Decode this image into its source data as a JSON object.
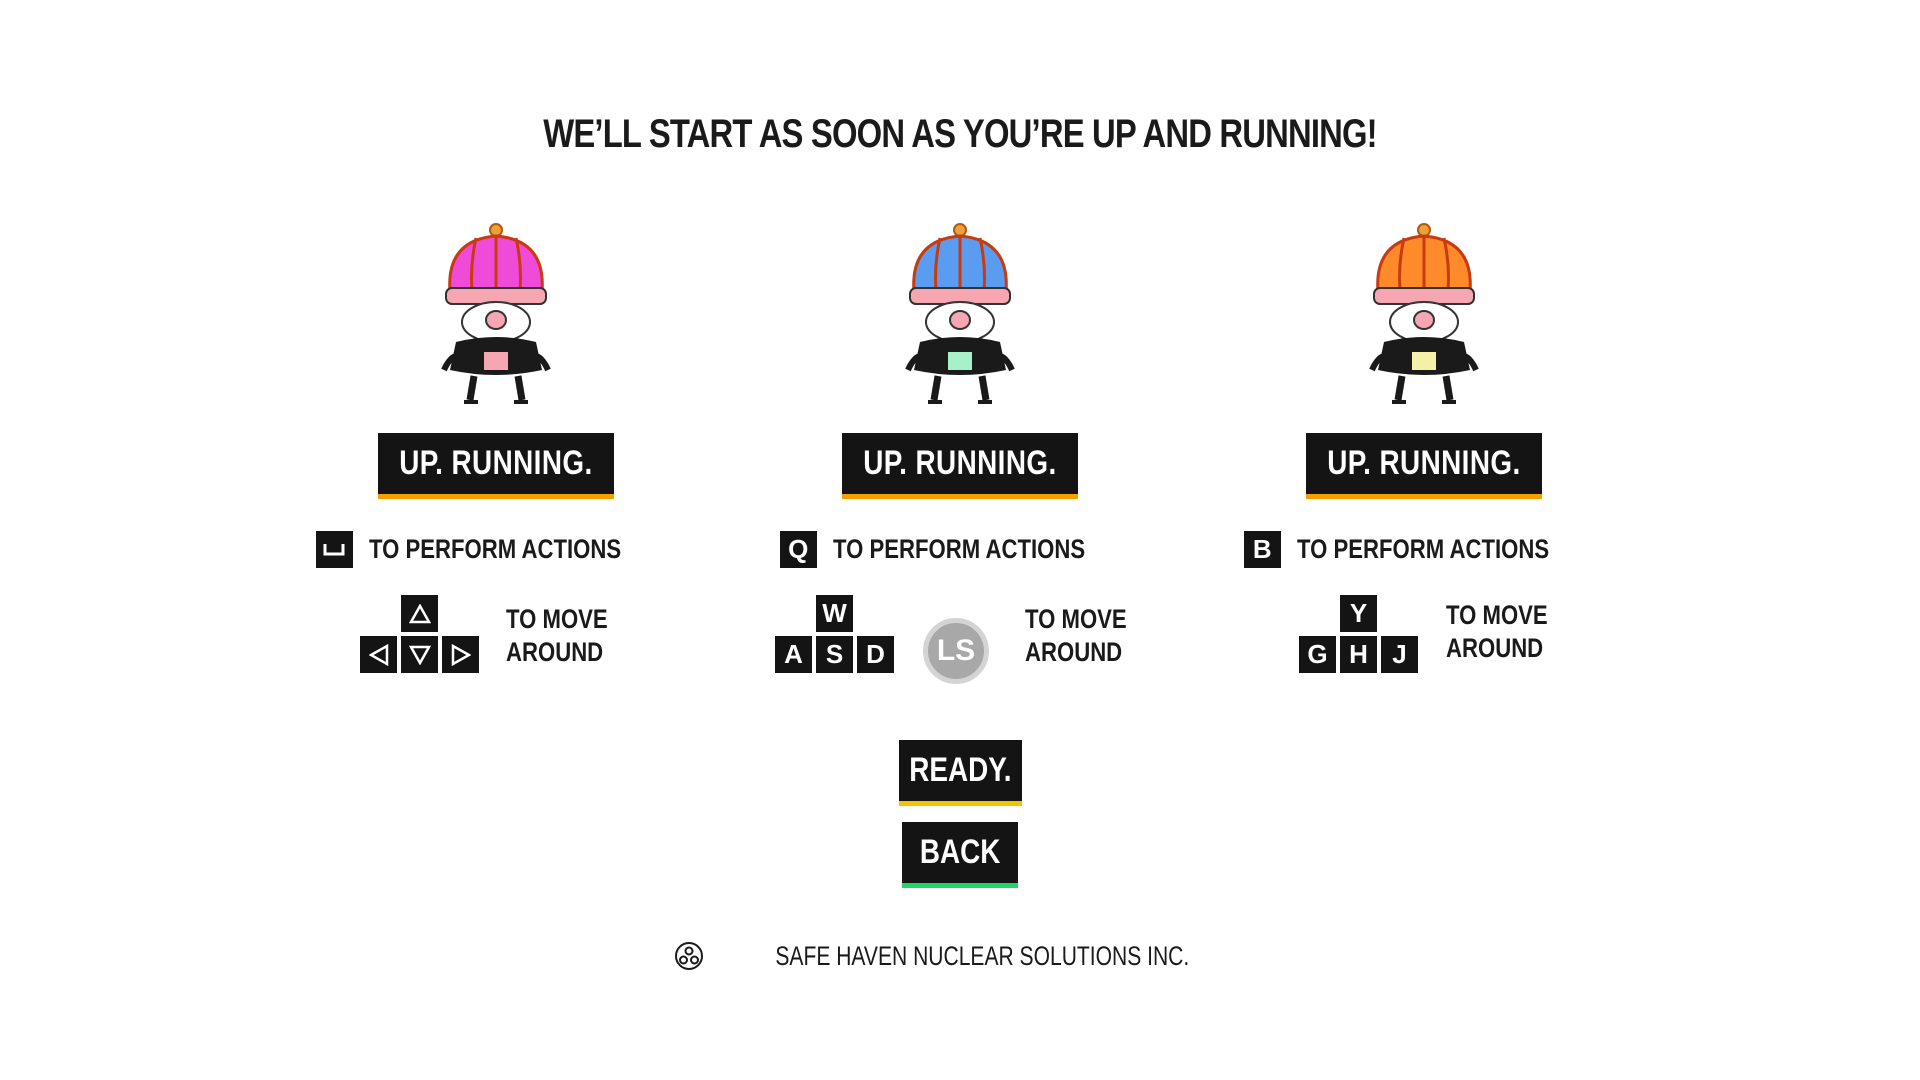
{
  "header": {
    "title": "WE’LL START AS SOON AS YOU’RE UP AND RUNNING!"
  },
  "players": [
    {
      "hat_color": "#f04ad8",
      "status_label": "UP. RUNNING.",
      "action_key": "␣",
      "action_key_icon": "spacebar-icon",
      "action_text": "TO PERFORM ACTIONS",
      "move_keys": {
        "up": "△",
        "left": "◁",
        "down": "▽",
        "right": "▷"
      },
      "move_text_line1": "TO MOVE",
      "move_text_line2": "AROUND"
    },
    {
      "hat_color": "#5a9cf0",
      "status_label": "UP. RUNNING.",
      "action_key": "Q",
      "action_text": "TO PERFORM ACTIONS",
      "move_keys": {
        "up": "W",
        "left": "A",
        "down": "S",
        "right": "D"
      },
      "stick_label": "LS",
      "move_text_line1": "TO MOVE",
      "move_text_line2": "AROUND"
    },
    {
      "hat_color": "#ff8a2a",
      "status_label": "UP. RUNNING.",
      "action_key": "B",
      "action_text": "TO PERFORM ACTIONS",
      "move_keys": {
        "up": "Y",
        "left": "G",
        "down": "H",
        "right": "J"
      },
      "move_text_line1": "TO MOVE",
      "move_text_line2": "AROUND"
    }
  ],
  "buttons": {
    "ready": "READY.",
    "back": "BACK"
  },
  "footer": {
    "company": "SAFE HAVEN NUCLEAR SOLUTIONS INC.",
    "icon": "gamepad-icon"
  },
  "colors": {
    "ready_underline": "#f5c400",
    "back_underline": "#1ed760",
    "status_underline": "#f5a000"
  }
}
